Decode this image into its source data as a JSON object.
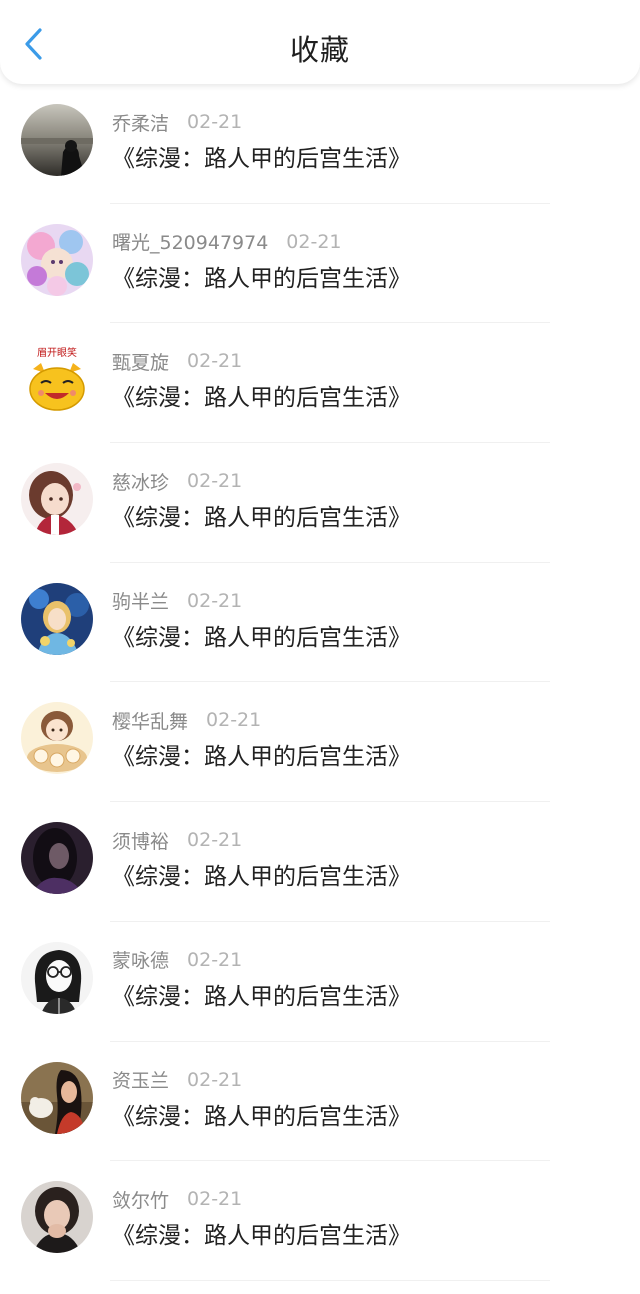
{
  "header": {
    "title": "收藏",
    "back_icon": "chevron-left-icon",
    "accent_color": "#3b9be8"
  },
  "items": [
    {
      "user": "乔柔洁",
      "date": "02-21",
      "title": "《综漫：路人甲的后宫生活》",
      "avatar": "avatar-photo-beach"
    },
    {
      "user": "曙光_520947974",
      "date": "02-21",
      "title": "《综漫：路人甲的后宫生活》",
      "avatar": "avatar-anime-colorful"
    },
    {
      "user": "甄夏旋",
      "date": "02-21",
      "title": "《综漫：路人甲的后宫生活》",
      "avatar": "avatar-cartoon-cat",
      "avatar_caption": "眉开眼笑"
    },
    {
      "user": "慈冰珍",
      "date": "02-21",
      "title": "《综漫：路人甲的后宫生活》",
      "avatar": "avatar-anime-girl"
    },
    {
      "user": "驹半兰",
      "date": "02-21",
      "title": "《综漫：路人甲的后宫生活》",
      "avatar": "avatar-anime-blue"
    },
    {
      "user": "樱华乱舞",
      "date": "02-21",
      "title": "《综漫：路人甲的后宫生活》",
      "avatar": "avatar-chibi-food"
    },
    {
      "user": "须博裕",
      "date": "02-21",
      "title": "《综漫：路人甲的后宫生活》",
      "avatar": "avatar-photo-dark"
    },
    {
      "user": "蒙咏德",
      "date": "02-21",
      "title": "《综漫：路人甲的后宫生活》",
      "avatar": "avatar-sketch-glasses"
    },
    {
      "user": "资玉兰",
      "date": "02-21",
      "title": "《综漫：路人甲的后宫生活》",
      "avatar": "avatar-illustration-woman"
    },
    {
      "user": "敛尔竹",
      "date": "02-21",
      "title": "《综漫：路人甲的后宫生活》",
      "avatar": "avatar-photo-girl"
    }
  ]
}
